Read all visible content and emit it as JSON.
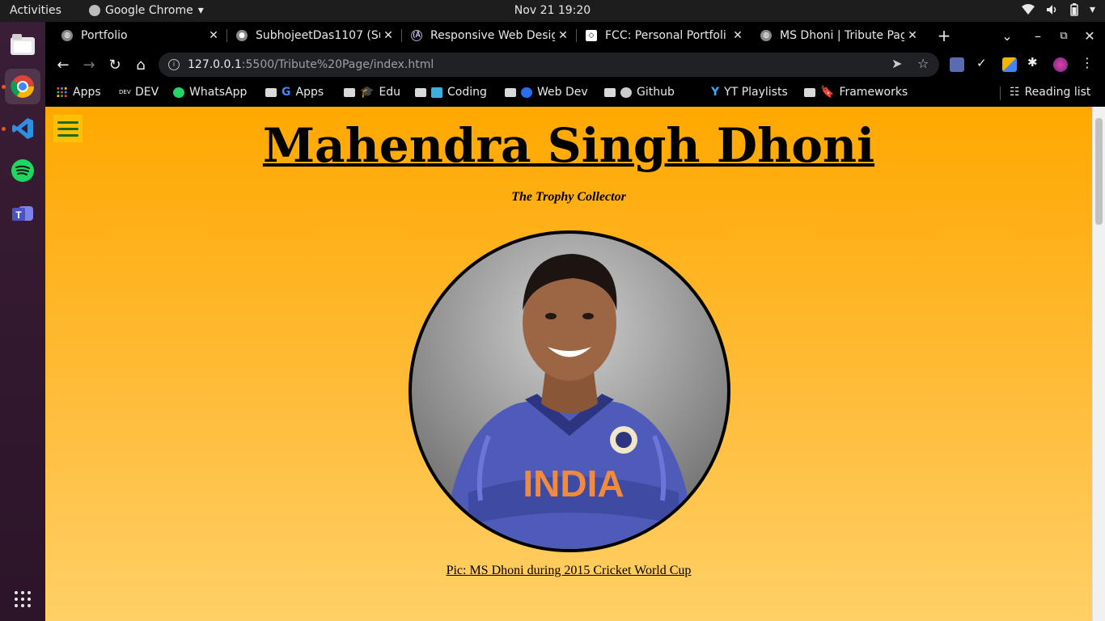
{
  "topbar": {
    "activities": "Activities",
    "app_name": "Google Chrome",
    "clock": "Nov 21  19:20",
    "tray_icons": [
      "wifi-icon",
      "volume-icon",
      "battery-icon",
      "caret-down-icon"
    ]
  },
  "dock": {
    "items": [
      "files-icon",
      "chrome-icon",
      "vscode-icon",
      "spotify-icon",
      "teams-icon"
    ],
    "apps_grid": "show-apps-icon"
  },
  "tabs": [
    {
      "title": "Portfolio",
      "icon": "globe-icon"
    },
    {
      "title": "SubhojeetDas1107 (Su",
      "icon": "github-icon"
    },
    {
      "title": "Responsive Web Desig",
      "icon": "freecodecamp-icon"
    },
    {
      "title": "FCC: Personal Portfoli",
      "icon": "codepen-icon"
    },
    {
      "title": "MS Dhoni | Tribute Pag",
      "icon": "globe-icon"
    }
  ],
  "toolbar": {
    "url_host": "127.0.0.1",
    "url_rest": ":5500/Tribute%20Page/index.html"
  },
  "bookmarks": [
    {
      "label": "Apps",
      "icon": "apps-grid-icon"
    },
    {
      "label": "DEV",
      "icon": "dev-icon"
    },
    {
      "label": "WhatsApp",
      "icon": "whatsapp-icon"
    },
    {
      "label": "Apps",
      "icon": "google-icon",
      "folder": true
    },
    {
      "label": "Edu",
      "icon": "graduation-cap-icon",
      "folder": true
    },
    {
      "label": "Coding",
      "icon": "coding-icon",
      "folder": true
    },
    {
      "label": "Web Dev",
      "icon": "web-dev-icon",
      "folder": true
    },
    {
      "label": "Github",
      "icon": "github-icon",
      "folder": true
    },
    {
      "label": "YT Playlists",
      "icon": "ycombinator-icon"
    },
    {
      "label": "Frameworks",
      "icon": "bookmark-ribbon-icon",
      "folder": true
    },
    {
      "label": "Reading list",
      "icon": "reading-list-icon"
    }
  ],
  "page": {
    "title": "Mahendra Singh Dhoni",
    "subtitle": "The Trophy Collector",
    "image_caption": "Pic: MS Dhoni during 2015 Cricket World Cup",
    "jersey_text": "INDIA"
  },
  "colors": {
    "page_top": "#ffa800",
    "page_bottom": "#ffd066",
    "jersey": "#4f5bb8",
    "hamburger": "#1c6b1c"
  }
}
